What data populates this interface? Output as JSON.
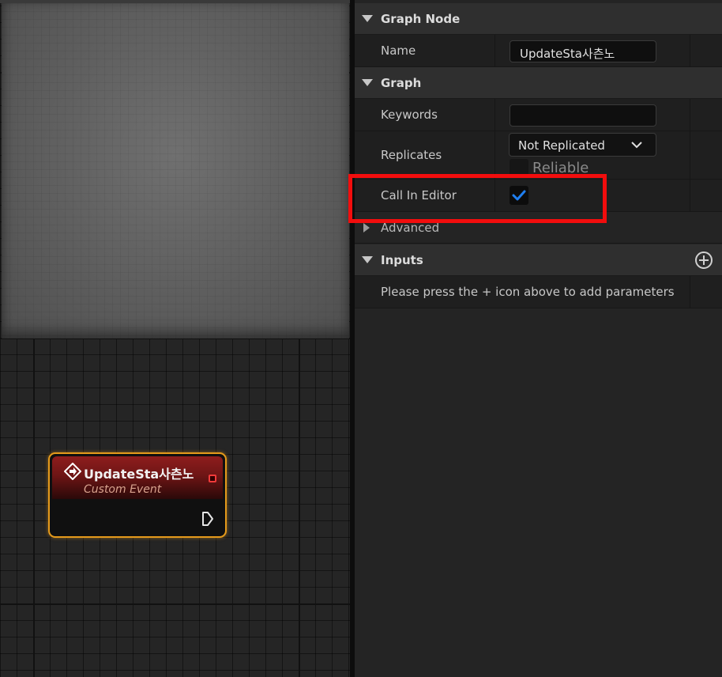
{
  "node": {
    "title": "UpdateSta사츤노",
    "subtitle": "Custom Event"
  },
  "details": {
    "graph_node_category": "Graph Node",
    "name_label": "Name",
    "name_value": "UpdateSta사츤노",
    "graph_category": "Graph",
    "keywords_label": "Keywords",
    "keywords_value": "",
    "replicates_label": "Replicates",
    "replicates_value": "Not Replicated",
    "reliable_label": "Reliable",
    "call_in_editor_label": "Call In Editor",
    "call_in_editor_checked": true,
    "advanced_label": "Advanced",
    "inputs_category": "Inputs",
    "inputs_hint": "Please press the + icon above to add parameters"
  },
  "colors": {
    "accent_check": "#1f7ff0",
    "highlight_box": "#f20d0d",
    "node_border": "#e59a1b",
    "node_header": "#8e1d1d"
  }
}
